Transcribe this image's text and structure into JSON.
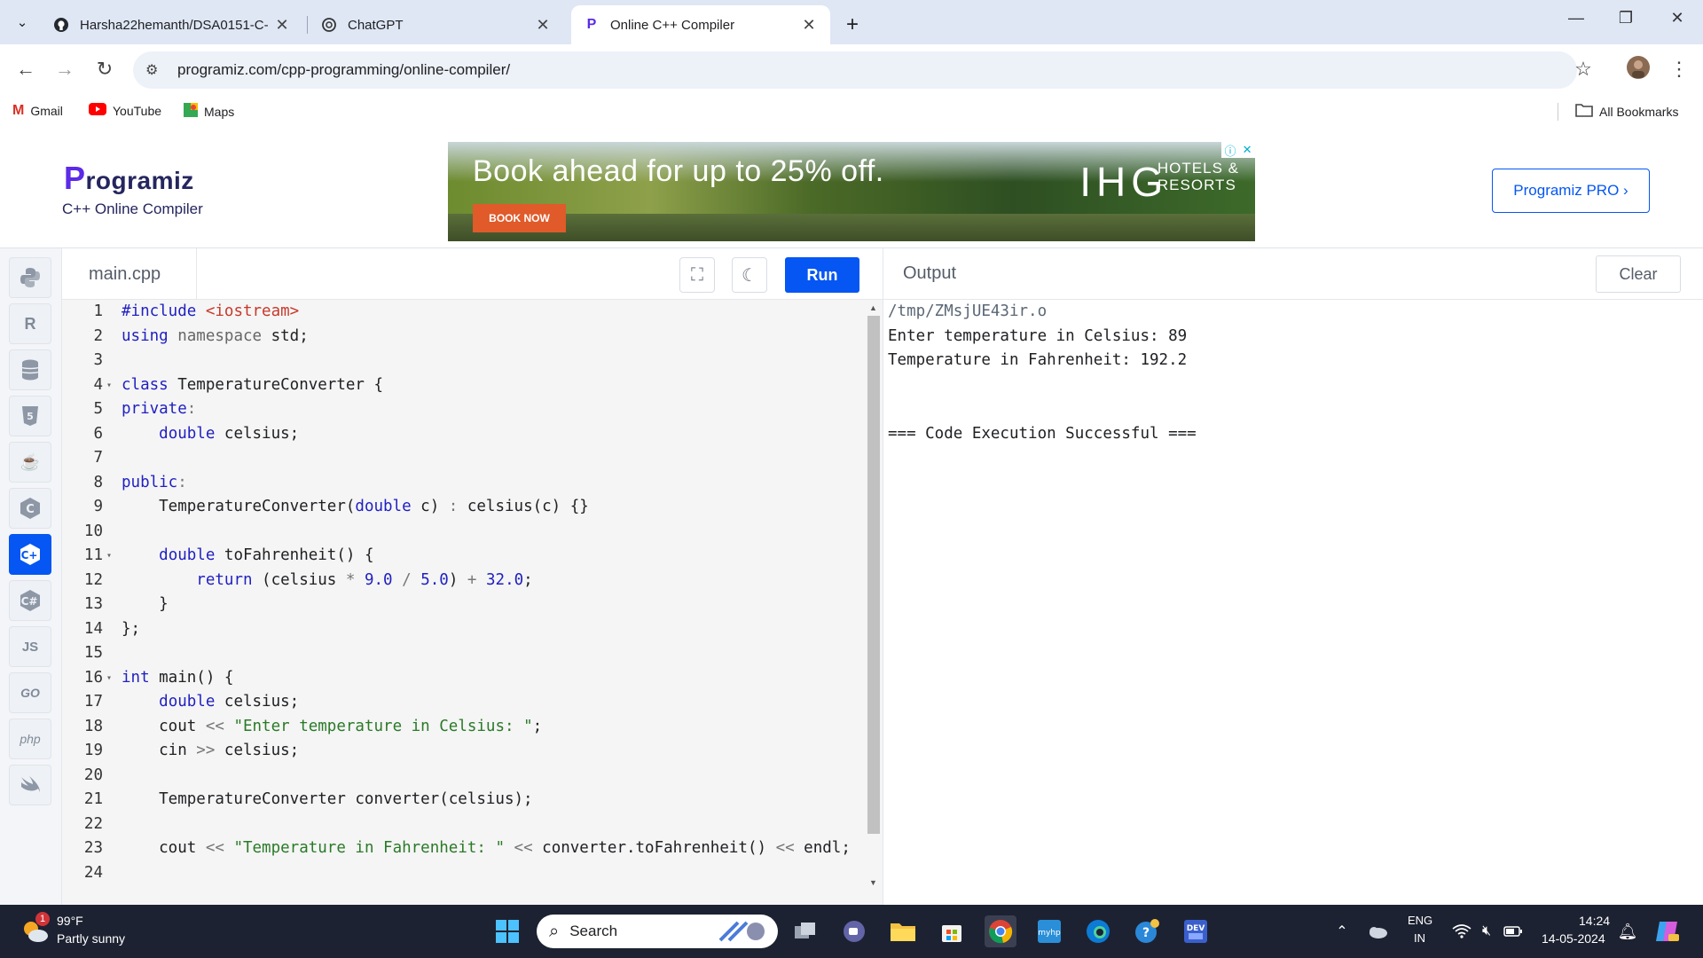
{
  "browser": {
    "tabs": [
      {
        "title": "Harsha22hemanth/DSA0151-C-",
        "favicon": "github-icon"
      },
      {
        "title": "ChatGPT",
        "favicon": "openai-icon"
      },
      {
        "title": "Online C++ Compiler",
        "favicon": "programiz-icon"
      }
    ],
    "url": "programiz.com/cpp-programming/online-compiler/",
    "bookmarks": [
      "Gmail",
      "YouTube",
      "Maps"
    ],
    "all_bookmarks": "All Bookmarks"
  },
  "site": {
    "logo_rest": "rogramiz",
    "logo_p": "P",
    "subtitle": "C++ Online Compiler",
    "pro_button": "Programiz PRO ›",
    "ad": {
      "headline": "Book ahead for up to 25% off.",
      "brand": "IHG",
      "brand_sub_1": "HOTELS &",
      "brand_sub_2": "RESORTS",
      "cta": "BOOK NOW"
    }
  },
  "editor": {
    "file_tab": "main.cpp",
    "run_label": "Run"
  },
  "output": {
    "title": "Output",
    "clear_label": "Clear",
    "lines": [
      "/tmp/ZMsjUE43ir.o",
      "Enter temperature in Celsius: 89",
      "Temperature in Fahrenheit: 192.2",
      "",
      "",
      "=== Code Execution Successful ==="
    ]
  },
  "languages": [
    "python",
    "r",
    "sql",
    "html",
    "java",
    "c",
    "cpp",
    "csharp",
    "js",
    "go",
    "php",
    "swift"
  ],
  "taskbar": {
    "weather_temp": "99°F",
    "weather_desc": "Partly sunny",
    "weather_badge": "1",
    "search_label": "Search",
    "lang_top": "ENG",
    "lang_bottom": "IN",
    "time": "14:24",
    "date": "14-05-2024"
  }
}
